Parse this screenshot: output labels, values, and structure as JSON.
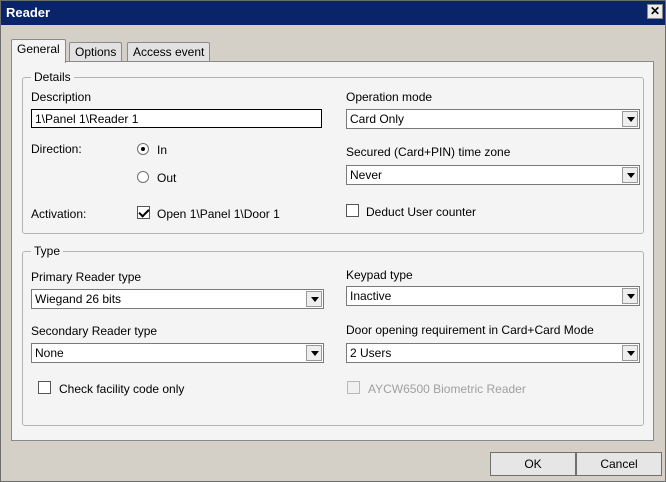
{
  "window": {
    "title": "Reader",
    "close_glyph": "✕"
  },
  "tabs": [
    {
      "label": "General",
      "active": true
    },
    {
      "label": "Options",
      "active": false
    },
    {
      "label": "Access event",
      "active": false
    }
  ],
  "details": {
    "legend": "Details",
    "description_label": "Description",
    "description_value": "1\\Panel 1\\Reader 1",
    "direction_label": "Direction:",
    "direction_options": [
      {
        "label": "In",
        "selected": true
      },
      {
        "label": "Out",
        "selected": false
      }
    ],
    "activation_label": "Activation:",
    "activation_checkbox": {
      "label": "Open 1\\Panel 1\\Door 1",
      "checked": true
    },
    "operation_mode_label": "Operation mode",
    "operation_mode_value": "Card Only",
    "secured_tz_label": "Secured (Card+PIN)  time zone",
    "secured_tz_value": "Never",
    "deduct_counter": {
      "label": "Deduct User counter",
      "checked": false
    }
  },
  "type": {
    "legend": "Type",
    "primary_label": "Primary Reader type",
    "primary_value": "Wiegand 26 bits",
    "secondary_label": "Secondary Reader type",
    "secondary_value": "None",
    "check_facility": {
      "label": "Check facility code only",
      "checked": false
    },
    "keypad_label": "Keypad type",
    "keypad_value": "Inactive",
    "door_req_label": "Door opening requirement in Card+Card Mode",
    "door_req_value": "2 Users",
    "biometric": {
      "label": "AYCW6500 Biometric Reader",
      "checked": false,
      "enabled": false
    }
  },
  "buttons": {
    "ok": "OK",
    "cancel": "Cancel"
  }
}
